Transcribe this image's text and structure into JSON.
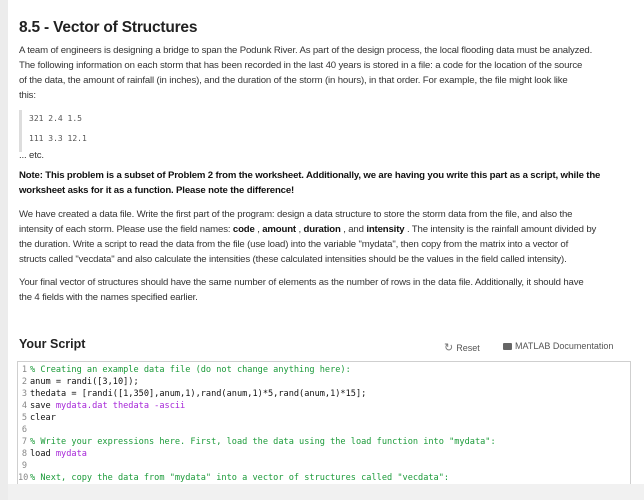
{
  "title": "8.5 - Vector of Structures",
  "intro_lines": [
    "A team of engineers is designing a bridge to span the Podunk River. As part of the design process, the local flooding data must be analyzed.",
    "The following information on each storm that has been recorded in the last 40 years is stored in a file: a code for the location of the source",
    "of the data, the amount of rainfall (in inches), and the duration of the storm (in hours), in that order. For example, the file might look like",
    "this:"
  ],
  "example_lines": [
    "321 2.4 1.5",
    "111 3.3 12.1"
  ],
  "etc": "... etc.",
  "note_lines": [
    "Note: This problem is a subset of Problem 2 from the worksheet. Additionally, we are having you write this part as a script, while the",
    "worksheet asks for it as a function. Please note the difference!"
  ],
  "para1": {
    "line1": "We have created a data file. Write the first part of the program: design a data structure to store the storm data from the file, and also the",
    "line2_pre": "intensity of each storm. Please use the field names: ",
    "fields": [
      "code",
      "amount",
      "duration",
      "intensity"
    ],
    "sep1": " , ",
    "sep2": " , ",
    "sep3": " , and ",
    "line2_post": " . The intensity is the rainfall amount divided by",
    "line3": "the duration. Write a script to read the data from the file (use load) into the variable \"mydata\", then copy from the matrix into a vector of",
    "line4": "structs called \"vecdata\" and also calculate the intensities (these calculated intensities should be the values in the field called intensity)."
  },
  "para2_lines": [
    "Your final vector of structures should have the same number of elements as the number of rows in the data file. Additionally, it should have",
    "the 4 fields with the names specified earlier."
  ],
  "script": {
    "header": "Your Script",
    "reset": "Reset",
    "docs": "MATLAB Documentation"
  },
  "code": [
    [
      {
        "t": "% Creating an example data file (do not change anything here):",
        "c": "cm"
      }
    ],
    [
      {
        "t": "anum = randi([3,10]);",
        "c": ""
      }
    ],
    [
      {
        "t": "thedata = [randi([1,350],anum,1),rand(anum,1)*5,rand(anum,1)*15];",
        "c": ""
      }
    ],
    [
      {
        "t": "save ",
        "c": ""
      },
      {
        "t": "mydata.dat thedata -ascii",
        "c": "str"
      }
    ],
    [
      {
        "t": "clear",
        "c": ""
      }
    ],
    [],
    [
      {
        "t": "% Write your expressions here. First, load the data using the load function into \"mydata\":",
        "c": "cm"
      }
    ],
    [
      {
        "t": "load ",
        "c": ""
      },
      {
        "t": "mydata",
        "c": "str"
      }
    ],
    [],
    [
      {
        "t": "% Next, copy the data from \"mydata\" into a vector of structures called \"vecdata\":",
        "c": "cm"
      }
    ],
    []
  ],
  "colors": {
    "comment": "#1c9b3a",
    "string": "#a626d8"
  }
}
